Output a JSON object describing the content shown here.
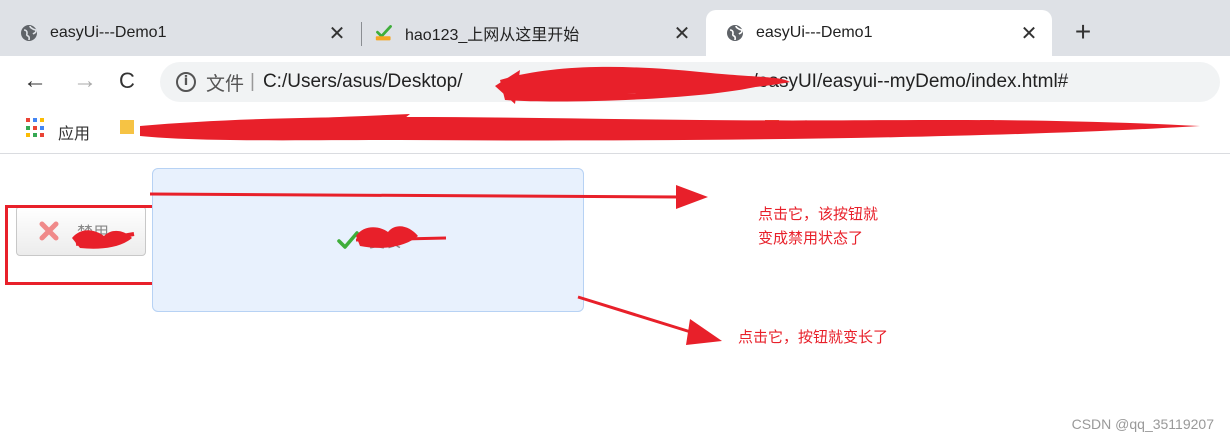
{
  "tabs": [
    {
      "title": "easyUi---Demo1",
      "icon": "globe-icon",
      "close": "✕",
      "active": false
    },
    {
      "title": "hao123_上网从这里开始",
      "icon": "hao123-logo-icon",
      "close": "✕",
      "active": false
    },
    {
      "title": "easyUi---Demo1",
      "icon": "globe-icon",
      "close": "✕",
      "active": true
    }
  ],
  "new_tab": "+",
  "nav": {
    "back": "←",
    "forward": "→",
    "reload": "C"
  },
  "address": {
    "info": "i",
    "scheme": "文件",
    "divider": "|",
    "url_start": "C:/Users/asus/Desktop/",
    "url_end": "/easyUI/easyui--myDemo/index.html#"
  },
  "bookmarks": {
    "apps_label": "应用"
  },
  "content": {
    "disable_button_label": "禁用",
    "resize_button_label": "变长"
  },
  "annotations": {
    "note1_line1": "点击它，该按钮就",
    "note1_line2": "变成禁用状态了",
    "note2": "点击它，按钮就变长了"
  },
  "watermark": "CSDN @qq_35119207",
  "colors": {
    "annotation_red": "#e8202a",
    "tab_strip": "#dee1e6",
    "omnibox": "#f1f3f4",
    "resize_button_bg": "#e8f1fd",
    "check_green": "#3fae3b"
  }
}
